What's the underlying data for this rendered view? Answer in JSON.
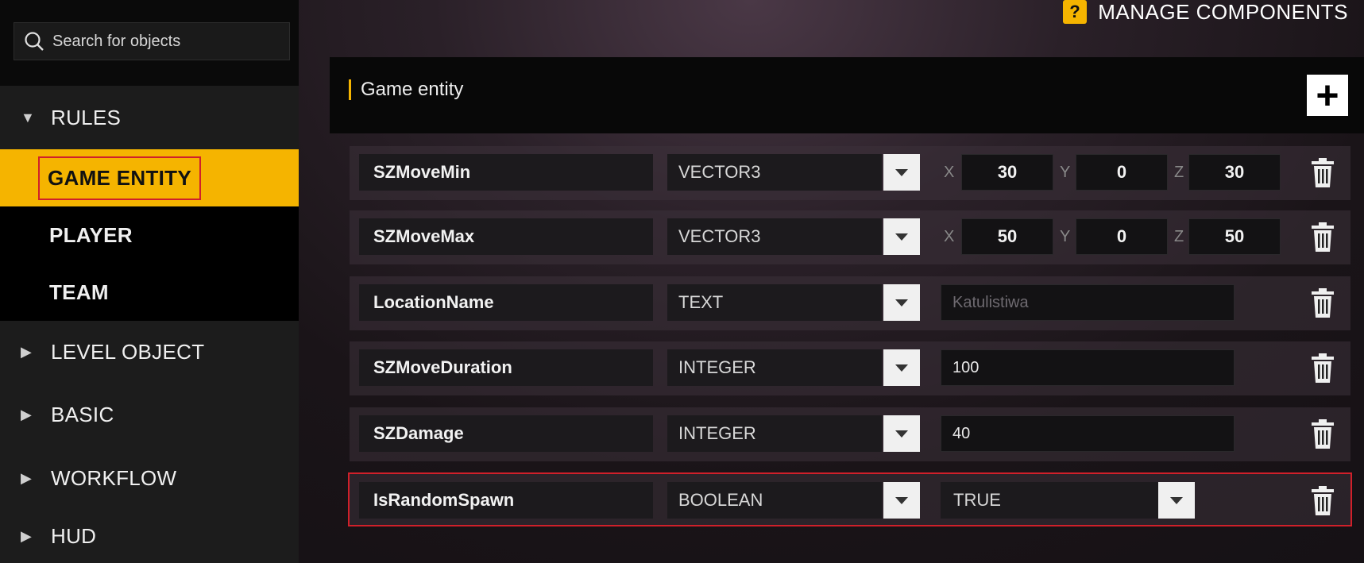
{
  "search": {
    "placeholder": "Search for objects"
  },
  "header": {
    "manage_label": "MANAGE COMPONENTS",
    "help_glyph": "?"
  },
  "sidebar": {
    "items": [
      {
        "label": "RULES",
        "kind": "category",
        "expanded": true
      },
      {
        "label": "GAME ENTITY",
        "kind": "sub",
        "active": true
      },
      {
        "label": "PLAYER",
        "kind": "sub"
      },
      {
        "label": "TEAM",
        "kind": "sub"
      },
      {
        "label": "LEVEL OBJECT",
        "kind": "category",
        "expanded": false
      },
      {
        "label": "BASIC",
        "kind": "category",
        "expanded": false
      },
      {
        "label": "WORKFLOW",
        "kind": "category",
        "expanded": false
      },
      {
        "label": "HUD",
        "kind": "category",
        "expanded": false
      }
    ]
  },
  "panel": {
    "title": "Game entity",
    "add_glyph": "+",
    "axis_labels": {
      "x": "X",
      "y": "Y",
      "z": "Z"
    },
    "rows": [
      {
        "name": "SZMoveMin",
        "type": "VECTOR3",
        "x": "30",
        "y": "0",
        "z": "30"
      },
      {
        "name": "SZMoveMax",
        "type": "VECTOR3",
        "x": "50",
        "y": "0",
        "z": "50"
      },
      {
        "name": "LocationName",
        "type": "TEXT",
        "placeholder": "Katulistiwa"
      },
      {
        "name": "SZMoveDuration",
        "type": "INTEGER",
        "value": "100"
      },
      {
        "name": "SZDamage",
        "type": "INTEGER",
        "value": "40"
      },
      {
        "name": "IsRandomSpawn",
        "type": "BOOLEAN",
        "value": "TRUE"
      }
    ]
  },
  "colors": {
    "accent": "#f5b400",
    "highlight_border": "#d0202a"
  }
}
